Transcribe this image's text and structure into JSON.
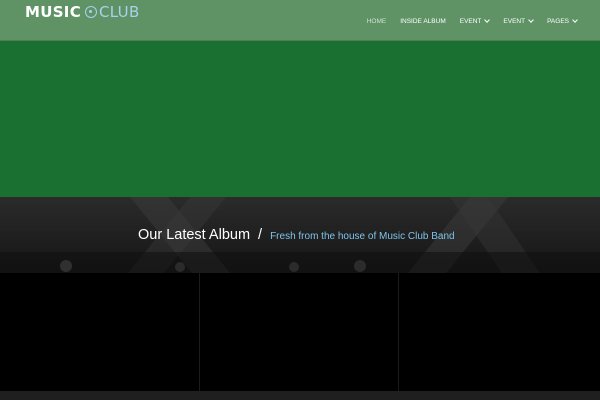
{
  "logo": {
    "part1": "MUSIC",
    "part2": "CLUB"
  },
  "nav": {
    "items": [
      {
        "label": "HOME",
        "active": true,
        "dropdown": false
      },
      {
        "label": "INSIDE ALBUM",
        "active": false,
        "dropdown": false
      },
      {
        "label": "EVENT",
        "active": false,
        "dropdown": true
      },
      {
        "label": "EVENT",
        "active": false,
        "dropdown": true
      },
      {
        "label": "PAGES",
        "active": false,
        "dropdown": true
      }
    ]
  },
  "banner": {
    "title": "Our Latest Album",
    "separator": "/",
    "subtitle": "Fresh from the house of Music Club Band"
  },
  "colors": {
    "header": "#5f9366",
    "hero": "#1a7030",
    "accent": "#7fc3ea"
  }
}
